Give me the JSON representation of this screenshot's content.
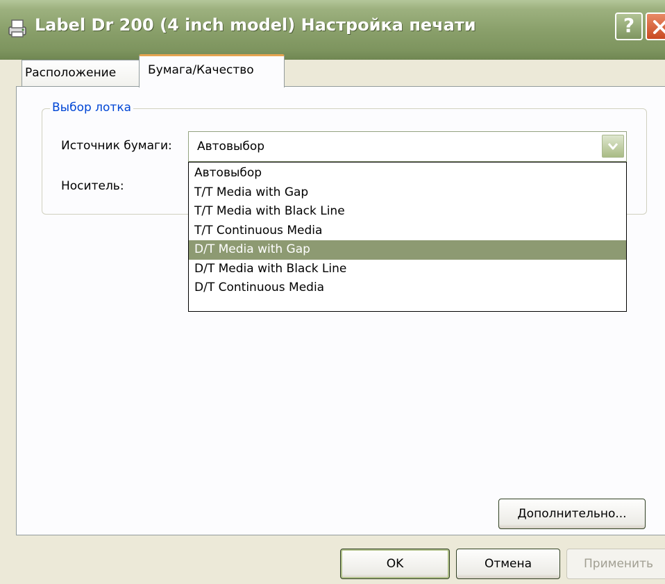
{
  "window": {
    "title": "Label Dr 200 (4 inch model) Настройка печати",
    "icon": "printer-icon",
    "help_label": "?",
    "close_icon": "close-icon"
  },
  "tabs": [
    {
      "label": "Расположение",
      "active": false
    },
    {
      "label": "Бумага/Качество",
      "active": true
    }
  ],
  "tray_group": {
    "legend": "Выбор лотка",
    "paper_source_label": "Источник бумаги:",
    "paper_source_value": "Автовыбор",
    "media_label": "Носитель:",
    "dropdown_options": [
      "Автовыбор",
      "T/T  Media with Gap",
      "T/T  Media with Black Line",
      "T/T  Continuous Media",
      "D/T  Media with Gap",
      "D/T  Media with Black Line",
      "D/T  Continuous Media"
    ],
    "highlighted_option": "D/T  Media with Gap"
  },
  "buttons": {
    "advanced": "Дополнительно...",
    "ok": "OK",
    "cancel": "Отмена",
    "apply": "Применить"
  },
  "colors": {
    "titlebar": "#8aa06b",
    "highlight": "#8d9a72",
    "legend_text": "#0046d5",
    "active_tab_accent": "#e5a450"
  }
}
